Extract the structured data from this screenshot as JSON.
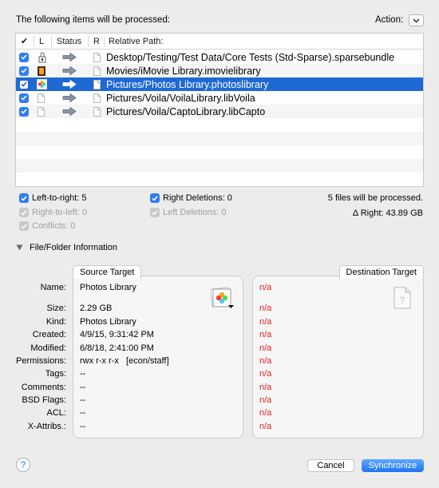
{
  "header": {
    "title": "The following items will be processed:",
    "action_label": "Action:",
    "action_icon": "chevron-down-icon"
  },
  "table": {
    "columns": [
      "✔",
      "L",
      "Status",
      "R",
      "Relative Path:"
    ],
    "rows": [
      {
        "checked": true,
        "left_icon": "sparsebundle-icon",
        "status_icon": "arrow-right-icon",
        "right_icon": "document-icon",
        "path": "Desktop/Testing/Test Data/Core Tests (Std-Sparse).sparsebundle",
        "selected": false
      },
      {
        "checked": true,
        "left_icon": "imovie-library-icon",
        "status_icon": "arrow-right-icon",
        "right_icon": "document-icon",
        "path": "Movies/iMovie Library.imovielibrary",
        "selected": false
      },
      {
        "checked": true,
        "left_icon": "photos-library-icon",
        "status_icon": "arrow-right-icon",
        "right_icon": "document-icon",
        "path": "Pictures/Photos Library.photoslibrary",
        "selected": true
      },
      {
        "checked": true,
        "left_icon": "document-icon",
        "status_icon": "arrow-right-icon",
        "right_icon": "document-icon",
        "path": "Pictures/Voila/VoilaLibrary.libVoila",
        "selected": false
      },
      {
        "checked": true,
        "left_icon": "document-icon",
        "status_icon": "arrow-right-icon",
        "right_icon": "document-icon",
        "path": "Pictures/Voila/CaptoLibrary.libCapto",
        "selected": false
      }
    ]
  },
  "stats": {
    "left_to_right": "Left-to-right: 5",
    "right_to_left": "Right-to-left: 0",
    "conflicts": "Conflicts: 0",
    "right_deletions": "Right Deletions: 0",
    "left_deletions": "Left Deletions: 0",
    "files_processed": "5 files will be processed.",
    "delta_right": "Δ Right: 43.89 GB"
  },
  "info": {
    "section_title": "File/Folder Information",
    "source_tab": "Source Target",
    "destination_tab": "Destination Target",
    "labels": [
      "Name:",
      "Size:",
      "Kind:",
      "Created:",
      "Modified:",
      "Permissions:",
      "Tags:",
      "Comments:",
      "BSD Flags:",
      "ACL:",
      "X-Attribs.:"
    ],
    "source_values": [
      "Photos Library",
      "2.29 GB",
      "Photos Library",
      "4/9/15, 9:31:42 PM",
      "6/8/18, 2:41:00 PM",
      "rwx r-x r-x   [econ/staff]",
      "--",
      "--",
      "--",
      "--",
      "--"
    ],
    "destination_values": [
      "n/a",
      "n/a",
      "n/a",
      "n/a",
      "n/a",
      "n/a",
      "n/a",
      "n/a",
      "n/a",
      "n/a",
      "n/a"
    ]
  },
  "footer": {
    "help_label": "?",
    "cancel_label": "Cancel",
    "sync_label": "Synchronize"
  },
  "colors": {
    "selection": "#1f69d5",
    "checkbox": "#2f7cf6",
    "na_text": "#e02020",
    "window_bg": "#ececec"
  }
}
